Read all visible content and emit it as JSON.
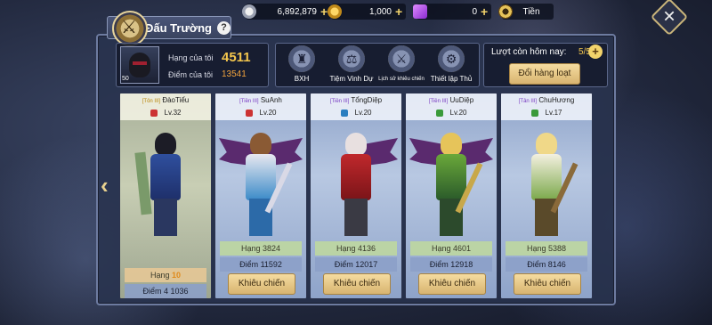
{
  "resources": [
    {
      "name": "silver-coin",
      "value": "6,892,879",
      "plus": "+"
    },
    {
      "name": "gold-coin",
      "value": "1,000",
      "plus": "+"
    },
    {
      "name": "gem",
      "value": "0",
      "plus": "+"
    },
    {
      "name": "currency",
      "value": "Tiền"
    }
  ],
  "close": "✕",
  "title": {
    "text": "Đấu Trường",
    "help": "?"
  },
  "player": {
    "level": "50",
    "rank_label": "Hạng của tôi",
    "rank_value": "4511",
    "score_label": "Điểm của tôi",
    "score_value": "13541"
  },
  "menu": [
    {
      "label": "BXH",
      "icon": "ranking-icon",
      "glyph": "♜"
    },
    {
      "label": "Tiệm Vinh Dự",
      "icon": "shop-scale-icon",
      "glyph": "⚖"
    },
    {
      "label": "Lịch sử khiêu chiến",
      "icon": "battle-history-icon",
      "glyph": "⚔"
    },
    {
      "label": "Thiết lập Thủ",
      "icon": "settings-gears-icon",
      "glyph": "⚙"
    }
  ],
  "turns": {
    "label": "Lượt còn hôm nay:",
    "count": "5/5",
    "plus": "+",
    "refresh": "Đổi hàng loạt"
  },
  "arrow": "‹",
  "cards": [
    {
      "vip": "[Tôn III]",
      "name": "ĐàoTiểu",
      "level": "Lv.32",
      "rank_label": "Hạng",
      "rank": "10",
      "score": "Điểm 4 1036"
    },
    {
      "vip": "[Tiền III]",
      "name": "SuAnh",
      "level": "Lv.20",
      "rank": "Hạng 3824",
      "score": "Điểm 11592",
      "fight": "Khiêu chiến"
    },
    {
      "vip": "[Tiền III]",
      "name": "TổngDiệp",
      "level": "Lv.20",
      "rank": "Hạng 4136",
      "score": "Điểm 12017",
      "fight": "Khiêu chiến"
    },
    {
      "vip": "[Tiền III]",
      "name": "UuDiệp",
      "level": "Lv.20",
      "rank": "Hạng 4601",
      "score": "Điểm 12918",
      "fight": "Khiêu chiến"
    },
    {
      "vip": "[Tân III]",
      "name": "ChuHương",
      "level": "Lv.17",
      "rank": "Hạng 5388",
      "score": "Điểm 8146",
      "fight": "Khiêu chiến"
    }
  ]
}
